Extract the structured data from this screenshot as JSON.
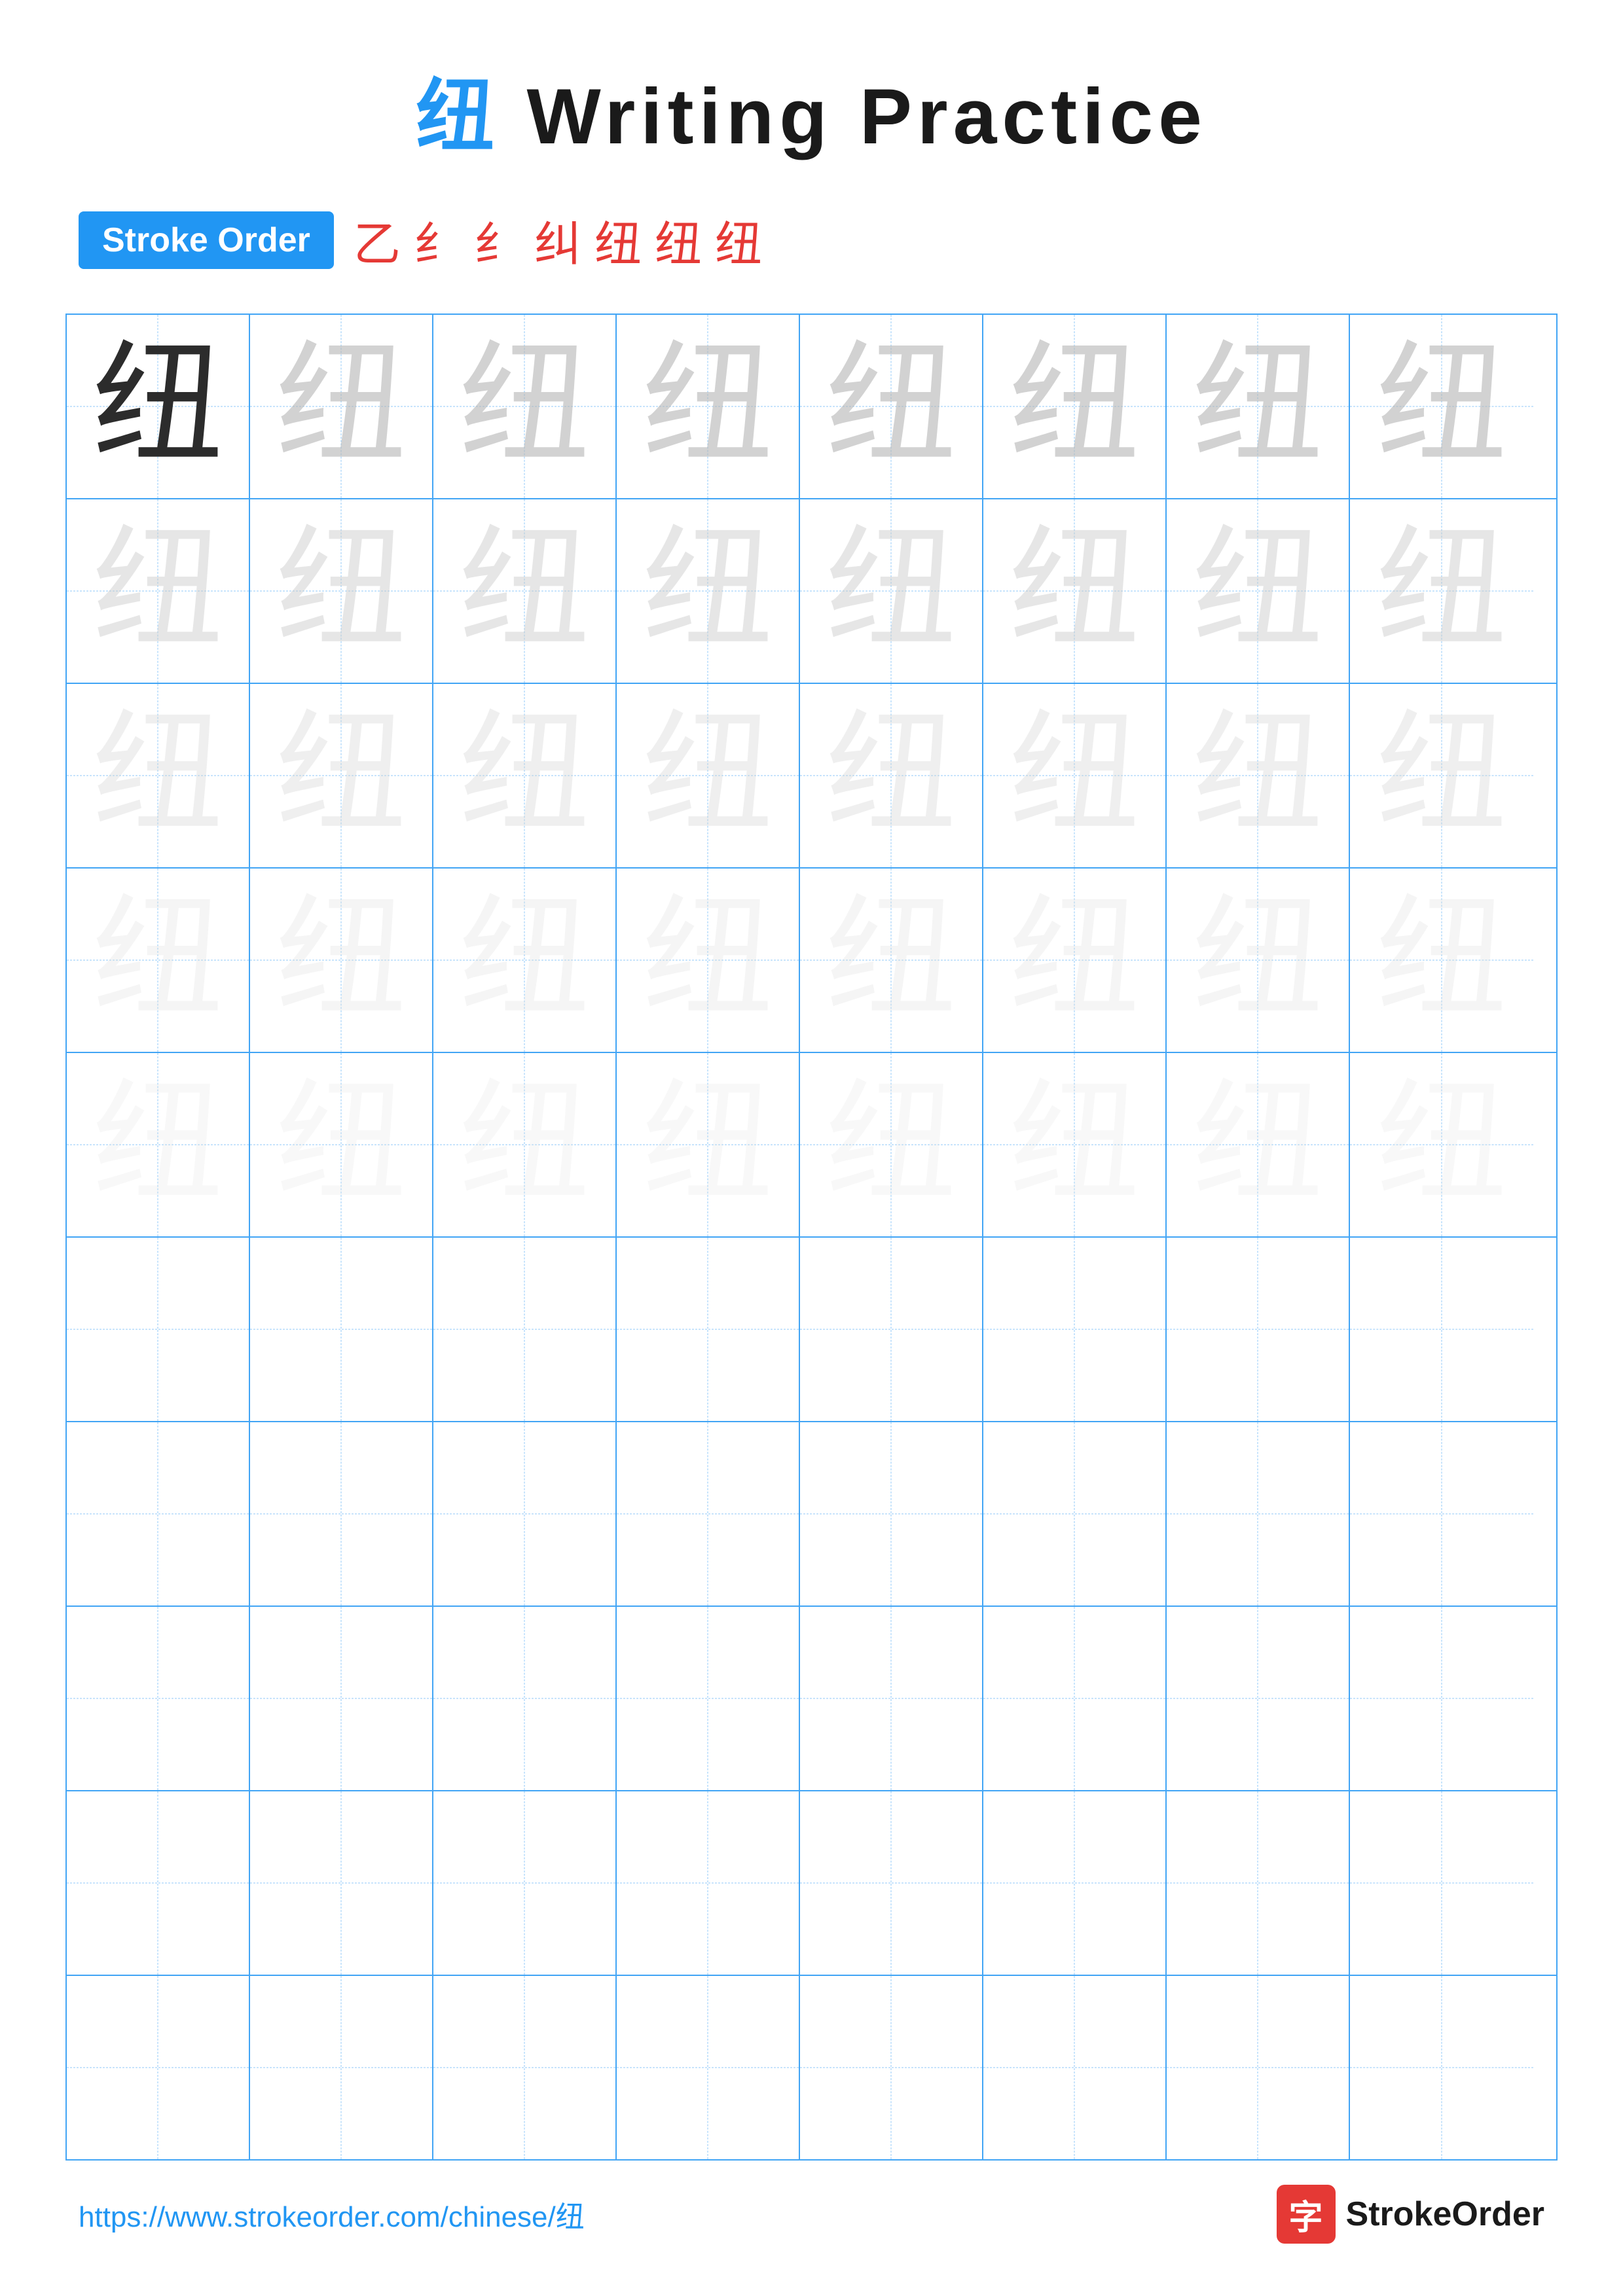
{
  "page": {
    "title_char": "纽",
    "title_english": " Writing Practice"
  },
  "stroke_order": {
    "badge_label": "Stroke Order",
    "sequence": [
      "乙",
      "纟",
      "纟",
      "纠",
      "纽",
      "纽",
      "纽"
    ]
  },
  "grid": {
    "cols": 8,
    "practice_char": "纽",
    "rows_with_char": 5,
    "rows_empty": 5
  },
  "footer": {
    "url": "https://www.strokeorder.com/chinese/纽",
    "logo_char": "字",
    "logo_text": "StrokeOrder"
  }
}
